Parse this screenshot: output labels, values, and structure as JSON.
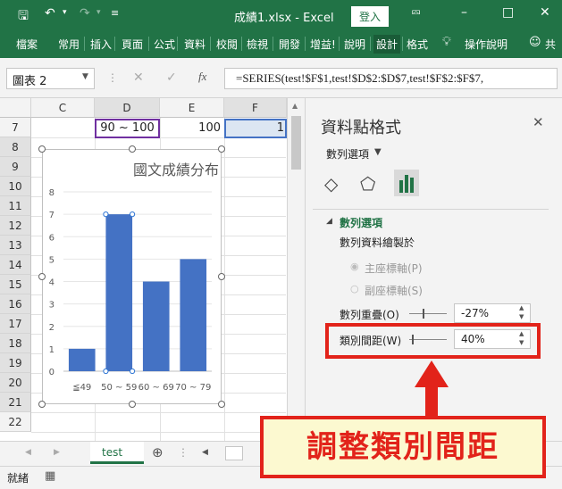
{
  "titlebar": {
    "title": "成績1.xlsx - Excel",
    "login": "登入"
  },
  "ribbon": {
    "tabs": [
      "檔案",
      "常用",
      "插入",
      "頁面",
      "公式",
      "資料",
      "校閱",
      "檢視",
      "開發",
      "增益!",
      "說明",
      "設計",
      "格式"
    ],
    "tell_me": "操作說明",
    "share": "共"
  },
  "formula_bar": {
    "name_box": "圖表 2",
    "fx": "fx",
    "formula": "=SERIES(test!$F$1,test!$D$2:$D$7,test!$F$2:$F$7,"
  },
  "grid": {
    "columns": [
      "C",
      "D",
      "E",
      "F"
    ],
    "rows": [
      "7",
      "8",
      "9",
      "10",
      "11",
      "12",
      "13",
      "14",
      "15",
      "16",
      "17",
      "18",
      "19",
      "20",
      "21",
      "22"
    ],
    "row7": {
      "d": "90 ~ 100",
      "e": "100",
      "f": "1"
    }
  },
  "chart_data": {
    "type": "bar",
    "title": "國文成績分布",
    "categories": [
      "≦49",
      "50 ~ 59",
      "60 ~ 69",
      "70 ~ 79"
    ],
    "values": [
      1,
      7,
      4,
      5
    ],
    "ylim": [
      0,
      8
    ],
    "yticks": [
      "0",
      "1",
      "2",
      "3",
      "4",
      "5",
      "6",
      "7",
      "8"
    ],
    "color": "#4472c4",
    "selected_index": 1,
    "grid": true
  },
  "pane": {
    "title": "資料點格式",
    "dropdown": "數列選項",
    "section": "數列選項",
    "plot_on": "數列資料繪製於",
    "primary_axis": "主座標軸(P)",
    "secondary_axis": "副座標軸(S)",
    "overlap_label": "數列重疊(O)",
    "overlap_value": "-27%",
    "gap_label": "類別間距(W)",
    "gap_value": "40%"
  },
  "sheet": {
    "tab": "test"
  },
  "status": {
    "ready": "就緒"
  },
  "callout": {
    "text": "調整類別間距"
  }
}
